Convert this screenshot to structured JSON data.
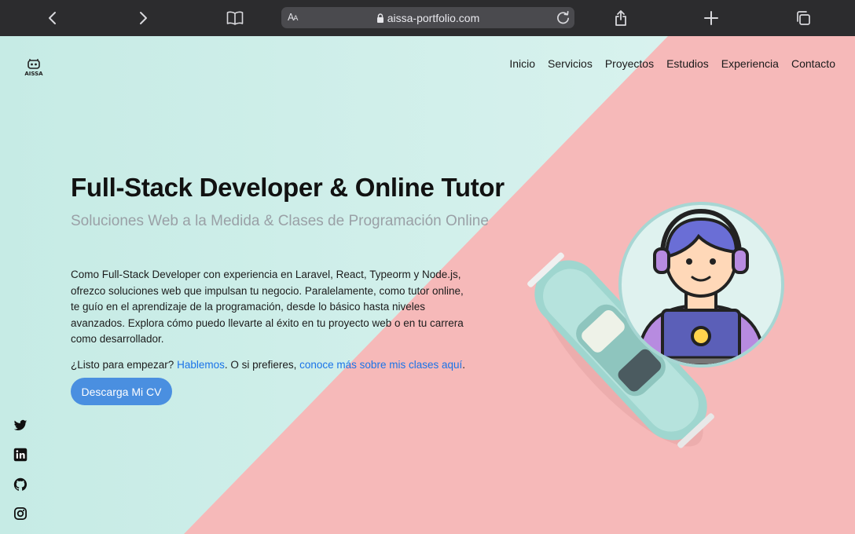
{
  "browser": {
    "aa_label": "AA",
    "url": "aissa-portfolio.com"
  },
  "site": {
    "logo_text": "AISSA",
    "nav": [
      "Inicio",
      "Servicios",
      "Proyectos",
      "Estudios",
      "Experiencia",
      "Contacto"
    ]
  },
  "hero": {
    "title": "Full-Stack Developer & Online Tutor",
    "subtitle": "Soluciones Web a la Medida & Clases de Programación Online",
    "description": "Como Full-Stack Developer con experiencia en Laravel, React, Typeorm y Node.js, ofrezco soluciones web que impulsan tu negocio. Paralelamente, como tutor online, te guío en el aprendizaje de la programación, desde lo básico hasta niveles avanzados. Explora cómo puedo llevarte al éxito en tu proyecto web o en tu carrera como desarrollador.",
    "cta_prefix": "¿Listo para empezar? ",
    "cta_link1": "Hablemos",
    "cta_middle": ". O si prefieres, ",
    "cta_link2": "conoce más sobre mis clases aquí",
    "cta_suffix": ".",
    "cv_button": "Descarga Mi CV"
  },
  "social": [
    "twitter-icon",
    "linkedin-icon",
    "github-icon",
    "instagram-icon"
  ],
  "colors": {
    "mint": "#c9ede7",
    "pink": "#f6b9b9",
    "accent": "#4a8fe0",
    "link": "#1a73e8"
  }
}
